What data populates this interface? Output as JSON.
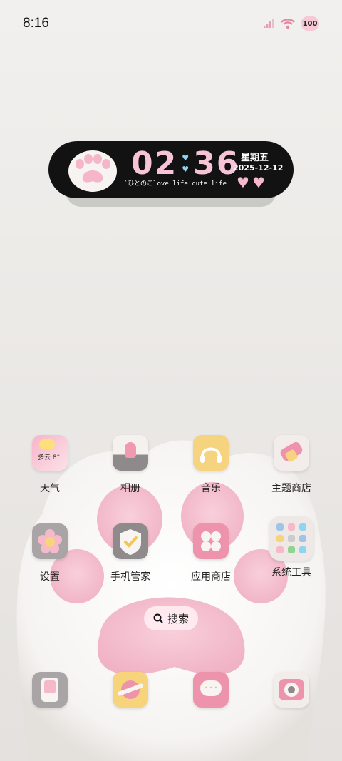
{
  "status_bar": {
    "time": "8:16",
    "battery": "100"
  },
  "widget": {
    "hour": "02",
    "minute": "36",
    "weekday": "星期五",
    "date": "2025-12-12",
    "tagline": "`ひとのこlove life cute life"
  },
  "apps_row1": [
    {
      "label": "天气",
      "icon": "weather-icon",
      "inner_text": "多云 8°"
    },
    {
      "label": "相册",
      "icon": "gallery-icon"
    },
    {
      "label": "音乐",
      "icon": "music-icon"
    },
    {
      "label": "主题商店",
      "icon": "theme-store-icon"
    }
  ],
  "apps_row2": [
    {
      "label": "设置",
      "icon": "settings-icon"
    },
    {
      "label": "手机管家",
      "icon": "phone-manager-icon"
    },
    {
      "label": "应用商店",
      "icon": "app-store-icon"
    },
    {
      "label": "系统工具",
      "icon": "system-tools-folder-icon"
    }
  ],
  "search": {
    "label": "搜索"
  },
  "dock": [
    {
      "icon": "phone-icon"
    },
    {
      "icon": "browser-icon"
    },
    {
      "icon": "messages-icon"
    },
    {
      "icon": "camera-icon"
    }
  ],
  "colors": {
    "pink": "#f6b8cc",
    "widget_bg": "#121212",
    "clock_pink": "#f7c3d6",
    "heart_blue": "#8fd4f0"
  }
}
